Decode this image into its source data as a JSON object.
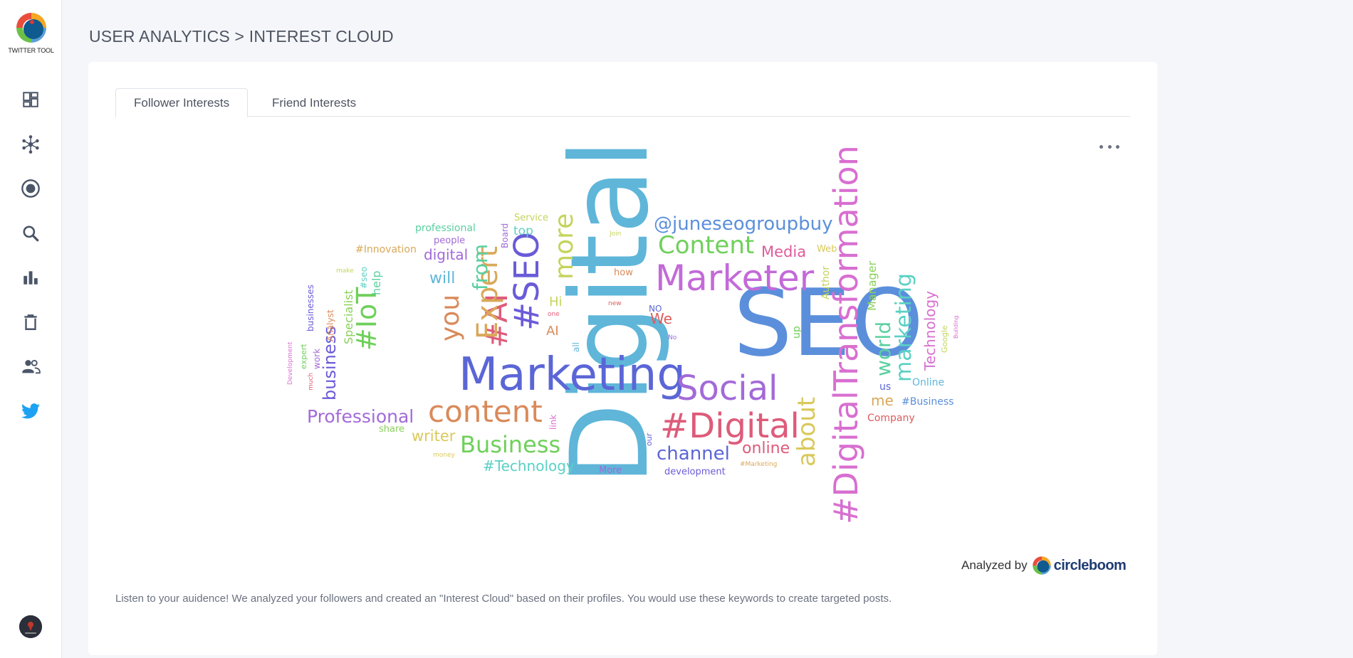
{
  "app": {
    "name": "TWITTER TOOL"
  },
  "nav": {
    "items": [
      {
        "id": "dashboard",
        "icon": "dashboard-icon"
      },
      {
        "id": "network",
        "icon": "network-icon"
      },
      {
        "id": "circle",
        "icon": "target-icon"
      },
      {
        "id": "search",
        "icon": "search-icon"
      },
      {
        "id": "analytics",
        "icon": "bar-chart-icon"
      },
      {
        "id": "delete",
        "icon": "trash-icon"
      },
      {
        "id": "users",
        "icon": "users-icon"
      },
      {
        "id": "twitter",
        "icon": "twitter-icon"
      }
    ],
    "active_color": "#1da1f2"
  },
  "page": {
    "breadcrumb": "USER ANALYTICS > INTEREST CLOUD"
  },
  "tabs": [
    {
      "label": "Follower Interests",
      "active": true
    },
    {
      "label": "Friend Interests",
      "active": false
    }
  ],
  "cloud": {
    "words": [
      {
        "text": "Digital",
        "color": "#5fb6d9"
      },
      {
        "text": "SEO",
        "color": "#5b8fdb"
      },
      {
        "text": "Marketing",
        "color": "#5b66d6"
      },
      {
        "text": "#DigitalTransformation",
        "color": "#d86fd0"
      },
      {
        "text": "Marketer",
        "color": "#c36ad8"
      },
      {
        "text": "Social",
        "color": "#a26ad8"
      },
      {
        "text": "#Digital",
        "color": "#de5b7a"
      },
      {
        "text": "content",
        "color": "#d98a5a"
      },
      {
        "text": "Business",
        "color": "#6fd05a"
      },
      {
        "text": "Content",
        "color": "#6fd05a"
      },
      {
        "text": "@juneseogroupbuy",
        "color": "#5b8fdb"
      },
      {
        "text": "#SEO",
        "color": "#6a5bd8"
      },
      {
        "text": "#AI",
        "color": "#de5b7a"
      },
      {
        "text": "Expert",
        "color": "#d9a85a"
      },
      {
        "text": "you",
        "color": "#d98a5a"
      },
      {
        "text": "more",
        "color": "#c4d45a"
      },
      {
        "text": "#IoT",
        "color": "#6fd05a"
      },
      {
        "text": "about",
        "color": "#d9c95a"
      },
      {
        "text": "marketing",
        "color": "#5ad0c4"
      },
      {
        "text": "world",
        "color": "#5ad0a0"
      },
      {
        "text": "Professional",
        "color": "#a26ad8"
      },
      {
        "text": "channel",
        "color": "#5b66d6"
      },
      {
        "text": "online",
        "color": "#de5b7a"
      },
      {
        "text": "Media",
        "color": "#de5b9a"
      },
      {
        "text": "Technology",
        "color": "#d86fd0"
      },
      {
        "text": "from",
        "color": "#5ad0a0"
      },
      {
        "text": "writer",
        "color": "#d9c95a"
      },
      {
        "text": "#Technology",
        "color": "#5ad0c4"
      },
      {
        "text": "business",
        "color": "#6a5bd8"
      },
      {
        "text": "digital",
        "color": "#a26ad8"
      },
      {
        "text": "will",
        "color": "#5fb6d9"
      },
      {
        "text": "me",
        "color": "#d9a85a"
      },
      {
        "text": "Manager",
        "color": "#8ad05a"
      },
      {
        "text": "Specialist",
        "color": "#8ad05a"
      },
      {
        "text": "We",
        "color": "#de5b5b"
      },
      {
        "text": "#Innovation",
        "color": "#d9a85a"
      },
      {
        "text": "professional",
        "color": "#5ad0a0"
      },
      {
        "text": "Hi",
        "color": "#c4d45a"
      },
      {
        "text": "AI",
        "color": "#d98a5a"
      },
      {
        "text": "up",
        "color": "#6fd05a"
      },
      {
        "text": "top",
        "color": "#5ad0c4"
      },
      {
        "text": "Service",
        "color": "#c4d45a"
      },
      {
        "text": "people",
        "color": "#a26ad8"
      },
      {
        "text": "Board",
        "color": "#a26ad8"
      },
      {
        "text": "help",
        "color": "#5ad0a0"
      },
      {
        "text": "#seo",
        "color": "#5ad0c4"
      },
      {
        "text": "Analyst",
        "color": "#d98a5a"
      },
      {
        "text": "businesses",
        "color": "#6a5bd8"
      },
      {
        "text": "work",
        "color": "#a26ad8"
      },
      {
        "text": "expert",
        "color": "#6fd05a"
      },
      {
        "text": "much",
        "color": "#de5b7a"
      },
      {
        "text": "Development",
        "color": "#d86fd0"
      },
      {
        "text": "Author",
        "color": "#c4d45a"
      },
      {
        "text": "Web",
        "color": "#d9c95a"
      },
      {
        "text": "how",
        "color": "#d98a5a"
      },
      {
        "text": "Join",
        "color": "#c4d45a"
      },
      {
        "text": "make",
        "color": "#c4d45a"
      },
      {
        "text": "one",
        "color": "#de5b7a"
      },
      {
        "text": "new",
        "color": "#de5b5b"
      },
      {
        "text": "NO",
        "color": "#5b66d6"
      },
      {
        "text": "No",
        "color": "#a26ad8"
      },
      {
        "text": "all",
        "color": "#5fb6d9"
      },
      {
        "text": "link",
        "color": "#d86fd0"
      },
      {
        "text": "share",
        "color": "#8ad05a"
      },
      {
        "text": "money",
        "color": "#d9c95a"
      },
      {
        "text": "our",
        "color": "#5b66d6"
      },
      {
        "text": "More",
        "color": "#a26ad8"
      },
      {
        "text": "development",
        "color": "#6a5bd8"
      },
      {
        "text": "#Marketing",
        "color": "#d9a85a"
      },
      {
        "text": "us",
        "color": "#5b66d6"
      },
      {
        "text": "#Business",
        "color": "#5b8fdb"
      },
      {
        "text": "Online",
        "color": "#5fb6d9"
      },
      {
        "text": "Company",
        "color": "#de5b5b"
      },
      {
        "text": "Google",
        "color": "#c4d45a"
      },
      {
        "text": "Building",
        "color": "#d86fd0"
      }
    ]
  },
  "analyzed": {
    "label": "Analyzed by",
    "brand": "circleboom"
  },
  "description": "Listen to your auidence! We analyzed your followers and created an \"Interest Cloud\" based on their profiles. You would use these keywords to create targeted posts."
}
